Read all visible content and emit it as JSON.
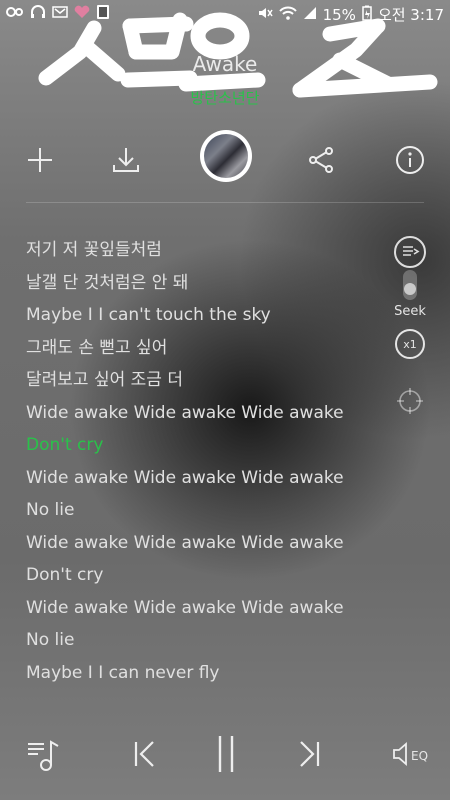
{
  "status": {
    "battery_text": "15%",
    "clock_text": "오전 3:17"
  },
  "song": {
    "title": "Awake",
    "artist": "방탄소년단"
  },
  "side": {
    "seek_label": "Seek",
    "speed_label": "x1"
  },
  "lyrics": [
    "저기 저 꽃잎들처럼",
    "날갤 단 것처럼은 안 돼",
    "Maybe I I can't touch the sky",
    "그래도 손 뻗고 싶어",
    "달려보고 싶어 조금 더",
    "Wide awake Wide awake Wide awake",
    "Don't cry",
    "Wide awake Wide awake Wide awake",
    "No lie",
    "Wide awake Wide awake Wide awake",
    "Don't cry",
    "Wide awake Wide awake Wide awake",
    "No lie",
    "Maybe I I can never fly"
  ],
  "active_lyric_index": 6,
  "player": {
    "eq_label": "EQ"
  },
  "colors": {
    "accent": "#29c24a"
  },
  "icons": {
    "add": "plus-icon",
    "download": "download-icon",
    "share": "share-icon",
    "info": "info-icon",
    "playlist": "playlist-icon",
    "previous": "previous-icon",
    "pause": "pause-icon",
    "next": "next-icon",
    "equalizer": "equalizer-icon"
  }
}
